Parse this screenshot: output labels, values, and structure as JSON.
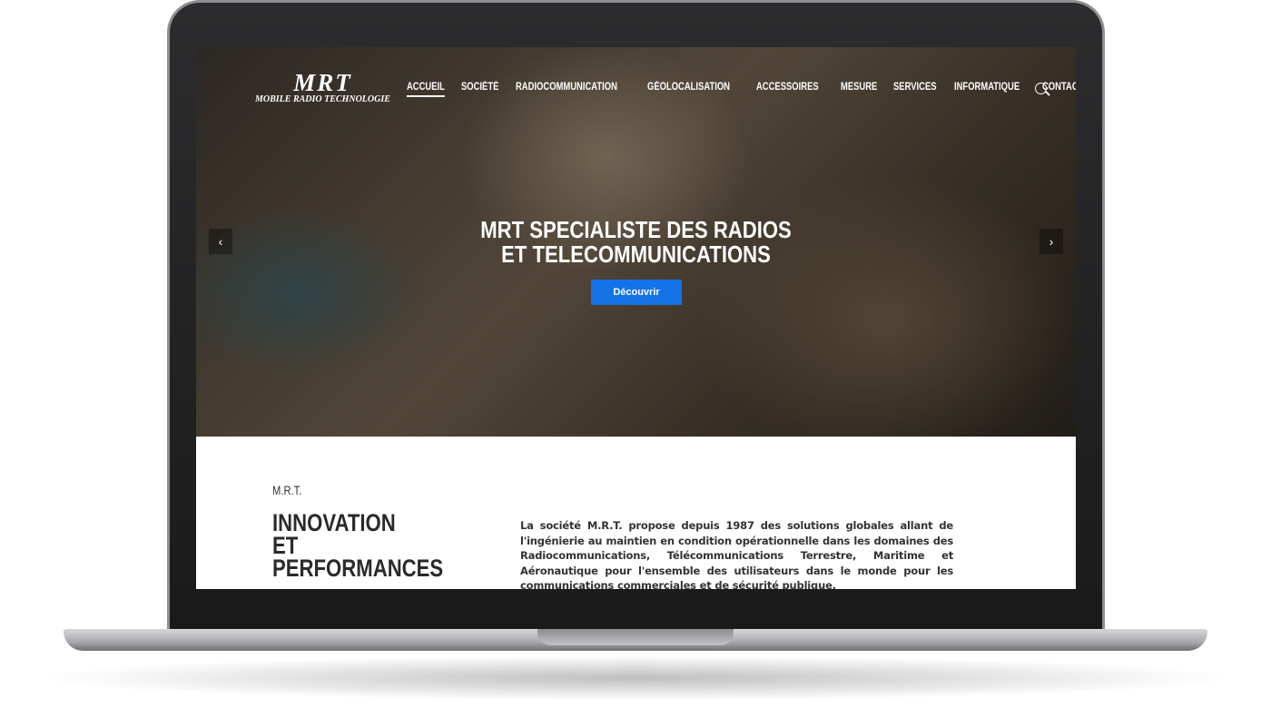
{
  "logo": {
    "title": "MRT",
    "subtitle": "MOBILE RADIO TECHNOLOGIE"
  },
  "nav": {
    "items": [
      "ACCUEIL",
      "SOCIÉTÉ",
      "RADIOCOMMUNICATION",
      "GÉOLOCALISATION",
      "ACCESSOIRES",
      "MESURE",
      "SERVICES",
      "INFORMATIQUE",
      "CONTACT"
    ],
    "active": "ACCUEIL",
    "search_icon": "search-icon"
  },
  "hero": {
    "title_line1": "MRT SPECIALISTE DES RADIOS",
    "title_line2": "ET TELECOMMUNICATIONS",
    "button": "Découvrir",
    "button_color": "#1473e6",
    "prev": "‹",
    "next": "›"
  },
  "intro": {
    "kicker": "M.R.T.",
    "heading": [
      "INNOVATION",
      "ET",
      "PERFORMANCES"
    ],
    "text": "La société M.R.T. propose depuis 1987 des solutions globales allant de l'ingénierie au maintien en condition opérationnelle dans les domaines des Radiocommunications, Télécommunications Terrestre, Maritime et Aéronautique pour l'ensemble des utilisateurs dans le monde pour les communications commerciales et de sécurité publique."
  }
}
